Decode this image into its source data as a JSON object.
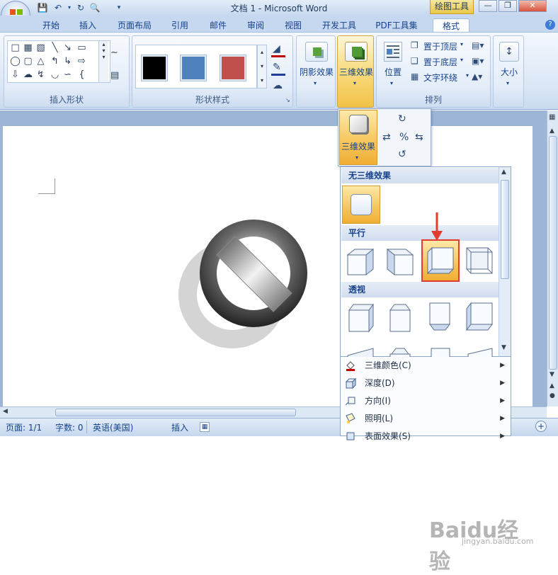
{
  "window": {
    "title": "文档 1 - Microsoft Word",
    "contextual_tab": "绘图工具"
  },
  "tabs": [
    "开始",
    "插入",
    "页面布局",
    "引用",
    "邮件",
    "审阅",
    "视图",
    "开发工具",
    "PDF工具集",
    "格式"
  ],
  "active_tab": "格式",
  "groups": {
    "insert_shapes": "插入形状",
    "shape_styles": "形状样式",
    "arrange": "排列"
  },
  "swatches": {
    "colors": [
      "#000000",
      "#4f81bd",
      "#c0504d"
    ]
  },
  "buttons": {
    "shadow_effects": "阴影效果",
    "3d_effects": "三维效果",
    "position": "位置",
    "bring_to_front": "置于顶层",
    "send_to_back": "置于底层",
    "text_wrapping": "文字环绕",
    "size": "大小"
  },
  "popup": {
    "3d_effects": "三维效果"
  },
  "gallery": {
    "no_3d": "无三维效果",
    "parallel": "平行",
    "perspective": "透视"
  },
  "menu": [
    {
      "label": "三维颜色(C)",
      "icon": "paint-bucket-icon"
    },
    {
      "label": "深度(D)",
      "icon": "depth-icon"
    },
    {
      "label": "方向(I)",
      "icon": "direction-icon"
    },
    {
      "label": "照明(L)",
      "icon": "lighting-icon"
    },
    {
      "label": "表面效果(S)",
      "icon": "surface-icon"
    }
  ],
  "status": {
    "page": "页面: 1/1",
    "words": "字数: 0",
    "language": "英语(美国)",
    "mode": "插入"
  },
  "watermark": {
    "brand": "Baidu经验",
    "url": "jingyan.baidu.com"
  }
}
